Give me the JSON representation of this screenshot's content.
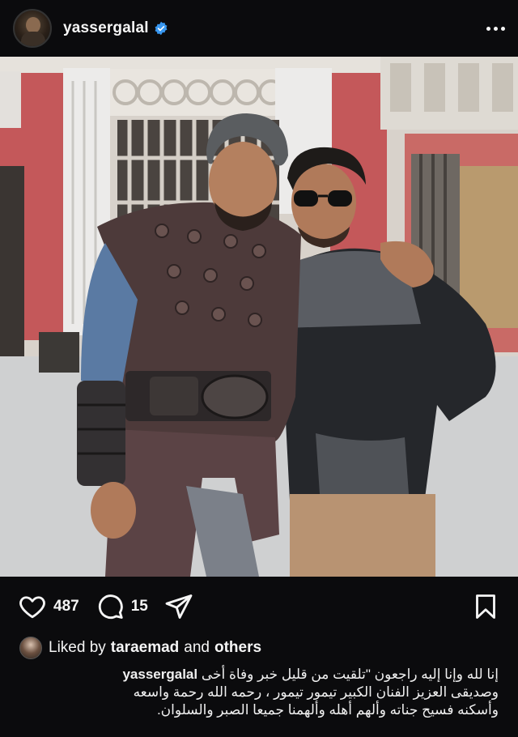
{
  "header": {
    "username": "yassergalal",
    "verified_color": "#3897f0",
    "avatar_icon": "profile-avatar",
    "more_icon": "more-options-icon"
  },
  "photo": {
    "icon": "post-photo"
  },
  "actions": {
    "likes_count": "487",
    "comments_count": "15",
    "like_icon": "heart-icon",
    "comment_icon": "comment-icon",
    "share_icon": "share-icon",
    "save_icon": "bookmark-icon"
  },
  "liked_by": {
    "prefix": "Liked by",
    "user": "taraemad",
    "connector": "and",
    "others": "others"
  },
  "caption": {
    "username": "yassergalal",
    "line1": "إنا لله وإنا إليه راجعون \"تلقيت من قليل خبر وفاة أخى",
    "line2": "وصديقى العزيز  الفنان الكبير تيمور تيمور ، رحمه الله رحمة واسعه",
    "line3": "وأسكنه فسيح جناته وألهم أهله وألهمنا جميعا الصبر والسلوان."
  }
}
